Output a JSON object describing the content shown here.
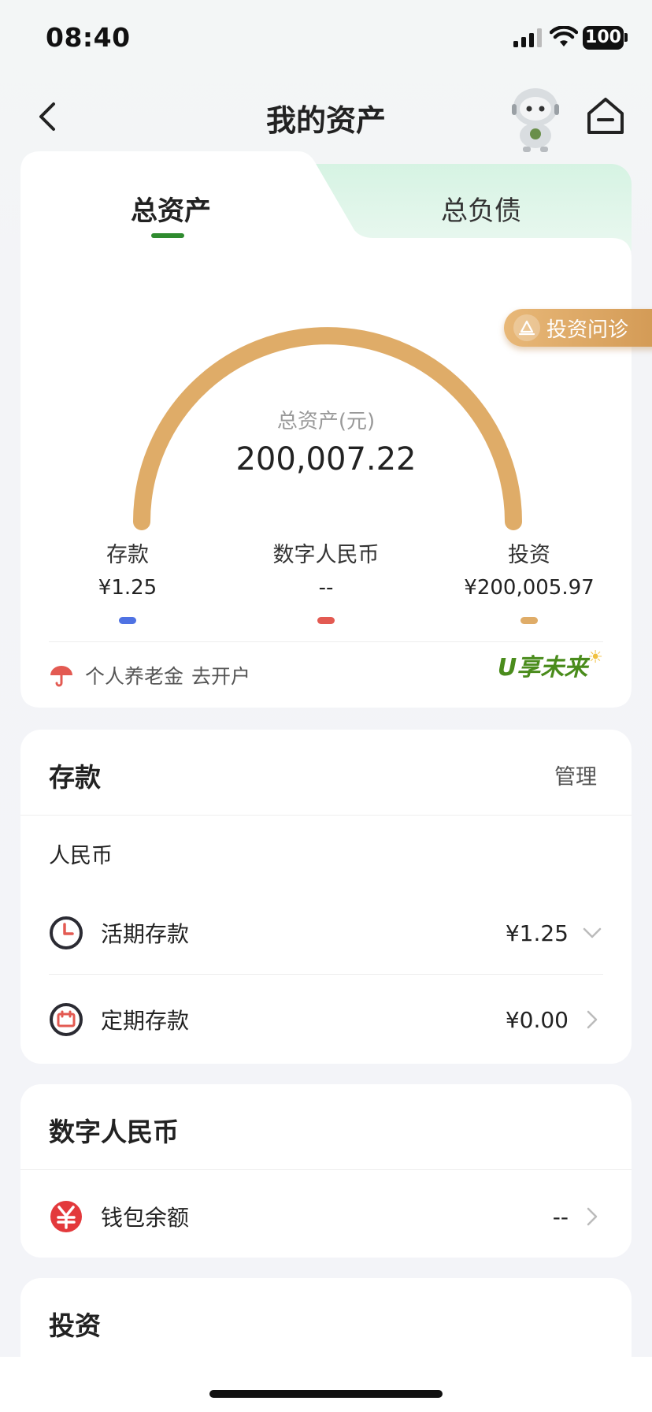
{
  "status_bar": {
    "time": "08:40",
    "battery": "100"
  },
  "nav": {
    "title": "我的资产"
  },
  "tabs": {
    "assets": "总资产",
    "liabilities": "总负债"
  },
  "invest_diagnosis": {
    "label": "投资问诊"
  },
  "gauge": {
    "label": "总资产(元)",
    "value": "200,007.22",
    "arc_color": "#dfac68"
  },
  "breakdown": [
    {
      "label": "存款",
      "value": "¥1.25",
      "color": "#4f72e3"
    },
    {
      "label": "数字人民币",
      "value": "--",
      "color": "#e35a52"
    },
    {
      "label": "投资",
      "value": "¥200,005.97",
      "color": "#dfac68"
    }
  ],
  "pension": {
    "text": "个人养老金",
    "action": "去开户",
    "logo": "U享未来"
  },
  "deposits": {
    "title": "存款",
    "manage": "管理",
    "currency": "人民币",
    "items": [
      {
        "label": "活期存款",
        "value": "¥1.25"
      },
      {
        "label": "定期存款",
        "value": "¥0.00"
      }
    ]
  },
  "digital_rmb": {
    "title": "数字人民币",
    "items": [
      {
        "label": "钱包余额",
        "value": "--"
      }
    ]
  },
  "investment": {
    "title": "投资"
  }
}
